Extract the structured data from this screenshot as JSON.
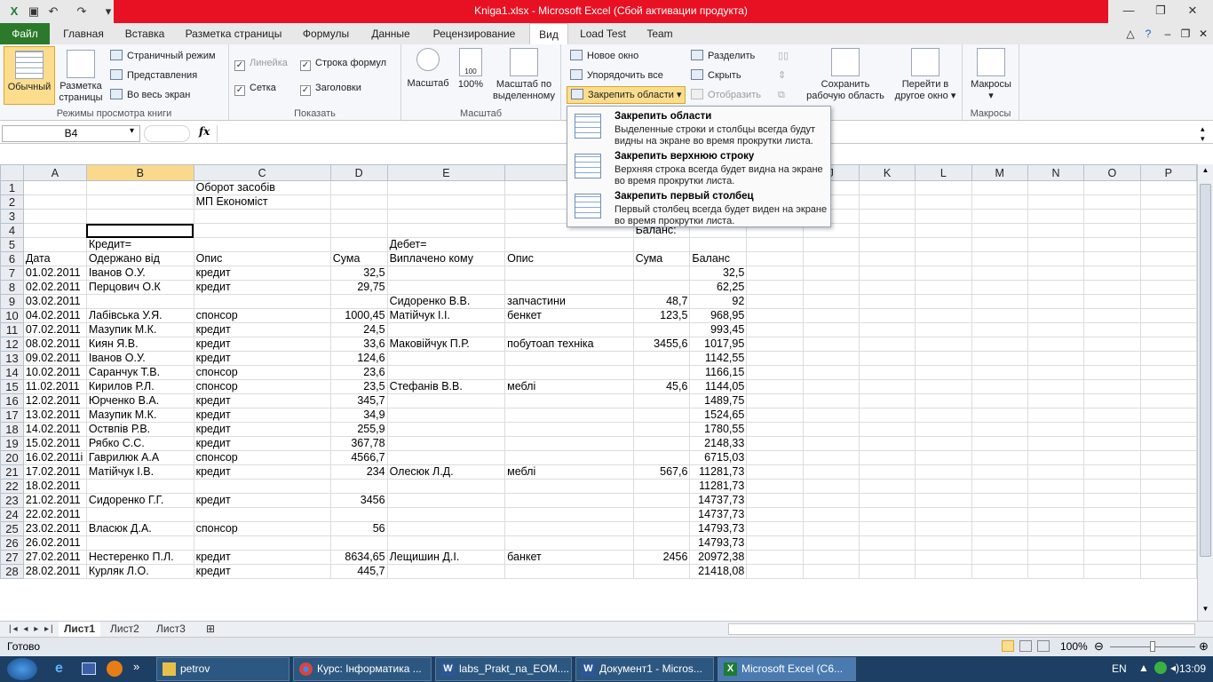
{
  "window": {
    "title": "Kniga1.xlsx  -  Microsoft Excel (Сбой активации продукта)",
    "minimize_icon": "minimize-icon",
    "restore_icon": "restore-icon",
    "close_icon": "close-icon",
    "accent_color": "#e81123"
  },
  "tabs": [
    "Файл",
    "Главная",
    "Вставка",
    "Разметка страницы",
    "Формулы",
    "Данные",
    "Рецензирование",
    "Вид",
    "Load Test",
    "Team"
  ],
  "active_tab": "Вид",
  "ribbon": {
    "views_group": {
      "label": "Режимы просмотра книги",
      "normal": "Обычный",
      "page_layout_line1": "Разметка",
      "page_layout_line2": "страницы",
      "page_mode": "Страничный режим",
      "views": "Представления",
      "full_screen": "Во весь экран"
    },
    "show_group": {
      "label": "Показать",
      "ruler": "Линейка",
      "formula_bar": "Строка формул",
      "grid": "Сетка",
      "headings": "Заголовки"
    },
    "zoom_group": {
      "label": "Масштаб",
      "zoom": "Масштаб",
      "zoom100": "100%",
      "zoom_sel_line1": "Масштаб по",
      "zoom_sel_line2": "выделенному"
    },
    "window_group": {
      "new_window": "Новое окно",
      "arrange_all": "Упорядочить все",
      "freeze": "Закрепить области",
      "split": "Разделить",
      "hide": "Скрыть",
      "unhide": "Отобразить",
      "save_ws_line1": "Сохранить",
      "save_ws_line2": "рабочую область",
      "switch_line1": "Перейти в",
      "switch_line2": "другое окно"
    },
    "macros_group": {
      "label": "Макросы",
      "macros": "Макросы"
    }
  },
  "formula_bar": {
    "name_box": "B4",
    "fx": "fx",
    "value": ""
  },
  "freeze_menu": [
    {
      "title": "Закрепить области",
      "desc": "Выделенные строки и столбцы всегда будут видны на экране во время прокрутки листа."
    },
    {
      "title": "Закрепить верхнюю строку",
      "desc": "Верхняя строка всегда будет видна на экране во время прокрутки листа."
    },
    {
      "title": "Закрепить первый столбец",
      "desc": "Первый столбец всегда будет виден на экране во время прокрутки листа."
    }
  ],
  "columns": [
    "A",
    "B",
    "C",
    "D",
    "E",
    "F",
    "G",
    "H",
    "I",
    "J",
    "K",
    "L",
    "M",
    "N",
    "O",
    "P"
  ],
  "selected_column": "B",
  "rows": [
    {
      "n": "1",
      "A": "",
      "B": "",
      "C": "Оборот засобів",
      "D": "",
      "E": "",
      "F": "",
      "G": "",
      "H": ""
    },
    {
      "n": "2",
      "A": "",
      "B": "",
      "C": "МП Економіст",
      "D": "",
      "E": "",
      "F": "",
      "G": "",
      "H": ""
    },
    {
      "n": "3",
      "A": "",
      "B": "",
      "C": "",
      "D": "",
      "E": "",
      "F": "",
      "G": "Початок",
      "H": ""
    },
    {
      "n": "4",
      "A": "",
      "B": "",
      "C": "",
      "D": "",
      "E": "",
      "F": "",
      "G": "Баланс:",
      "H": ""
    },
    {
      "n": "5",
      "A": "",
      "B": "Кредит=",
      "C": "",
      "D": "",
      "E": "Дебет=",
      "F": "",
      "G": "",
      "H": ""
    },
    {
      "n": "6",
      "A": "Дата",
      "B": "Одержано від",
      "C": "Опис",
      "D": "Сума",
      "E": "Виплачено кому",
      "F": "Опис",
      "G": "Сума",
      "H": "Баланс"
    },
    {
      "n": "7",
      "A": "01.02.2011",
      "B": "Іванов О.У.",
      "C": "кредит",
      "D": "32,5",
      "E": "",
      "F": "",
      "G": "",
      "H": "32,5"
    },
    {
      "n": "8",
      "A": "02.02.2011",
      "B": "Перцович О.К",
      "C": "кредит",
      "D": "29,75",
      "E": "",
      "F": "",
      "G": "",
      "H": "62,25"
    },
    {
      "n": "9",
      "A": "03.02.2011",
      "B": "",
      "C": "",
      "D": "",
      "E": "Сидоренко В.В.",
      "F": "запчастини",
      "G": "48,7",
      "H": "92"
    },
    {
      "n": "10",
      "A": "04.02.2011",
      "B": "Лабівська У.Я.",
      "C": "спонсор",
      "D": "1000,45",
      "E": "Матійчук І.І.",
      "F": "бенкет",
      "G": "123,5",
      "H": "968,95"
    },
    {
      "n": "11",
      "A": "07.02.2011",
      "B": "Мазупик М.К.",
      "C": "кредит",
      "D": "24,5",
      "E": "",
      "F": "",
      "G": "",
      "H": "993,45"
    },
    {
      "n": "12",
      "A": "08.02.2011",
      "B": "Киян Я.В.",
      "C": "кредит",
      "D": "33,6",
      "E": "Маковійчук П.Р.",
      "F": "побутоап техніка",
      "G": "3455,6",
      "H": "1017,95"
    },
    {
      "n": "13",
      "A": "09.02.2011",
      "B": "Іванов О.У.",
      "C": "кредит",
      "D": "124,6",
      "E": "",
      "F": "",
      "G": "",
      "H": "1142,55"
    },
    {
      "n": "14",
      "A": "10.02.2011",
      "B": "Саранчук Т.В.",
      "C": "спонсор",
      "D": "23,6",
      "E": "",
      "F": "",
      "G": "",
      "H": "1166,15"
    },
    {
      "n": "15",
      "A": "11.02.2011",
      "B": "Кирилов Р.Л.",
      "C": "спонсор",
      "D": "23,5",
      "E": "Стефанів В.В.",
      "F": "меблі",
      "G": "45,6",
      "H": "1144,05"
    },
    {
      "n": "16",
      "A": "12.02.2011",
      "B": "Юрченко В.А.",
      "C": "кредит",
      "D": "345,7",
      "E": "",
      "F": "",
      "G": "",
      "H": "1489,75"
    },
    {
      "n": "17",
      "A": "13.02.2011",
      "B": "Мазупик М.К.",
      "C": "кредит",
      "D": "34,9",
      "E": "",
      "F": "",
      "G": "",
      "H": "1524,65"
    },
    {
      "n": "18",
      "A": "14.02.2011",
      "B": "Оствпів Р.В.",
      "C": "кредит",
      "D": "255,9",
      "E": "",
      "F": "",
      "G": "",
      "H": "1780,55"
    },
    {
      "n": "19",
      "A": "15.02.2011",
      "B": "Рябко С.С.",
      "C": "кредит",
      "D": "367,78",
      "E": "",
      "F": "",
      "G": "",
      "H": "2148,33"
    },
    {
      "n": "20",
      "A": "16.02.2011і",
      "B": "Гаврилюк А.А",
      "C": "спонсор",
      "D": "4566,7",
      "E": "",
      "F": "",
      "G": "",
      "H": "6715,03"
    },
    {
      "n": "21",
      "A": "17.02.2011",
      "B": "Матійчук І.В.",
      "C": "кредит",
      "D": "234",
      "E": "Олесюк Л.Д.",
      "F": "меблі",
      "G": "567,6",
      "H": "11281,73"
    },
    {
      "n": "22",
      "A": "18.02.2011",
      "B": "",
      "C": "",
      "D": "",
      "E": "",
      "F": "",
      "G": "",
      "H": "11281,73"
    },
    {
      "n": "23",
      "A": "21.02.2011",
      "B": "Сидоренко Г.Г.",
      "C": "кредит",
      "D": "3456",
      "E": "",
      "F": "",
      "G": "",
      "H": "14737,73"
    },
    {
      "n": "24",
      "A": "22.02.2011",
      "B": "",
      "C": "",
      "D": "",
      "E": "",
      "F": "",
      "G": "",
      "H": "14737,73"
    },
    {
      "n": "25",
      "A": "23.02.2011",
      "B": "Власюк Д.А.",
      "C": "спонсор",
      "D": "56",
      "E": "",
      "F": "",
      "G": "",
      "H": "14793,73"
    },
    {
      "n": "26",
      "A": "26.02.2011",
      "B": "",
      "C": "",
      "D": "",
      "E": "",
      "F": "",
      "G": "",
      "H": "14793,73"
    },
    {
      "n": "27",
      "A": "27.02.2011",
      "B": "Нестеренко П.Л.",
      "C": "кредит",
      "D": "8634,65",
      "E": "Лещишин Д.І.",
      "F": "банкет",
      "G": "2456",
      "H": "20972,38"
    },
    {
      "n": "28",
      "A": "28.02.2011",
      "B": "Курляк Л.О.",
      "C": "кредит",
      "D": "445,7",
      "E": "",
      "F": "",
      "G": "",
      "H": "21418,08"
    }
  ],
  "sheet_tabs": [
    "Лист1",
    "Лист2",
    "Лист3"
  ],
  "active_sheet": "Лист1",
  "status": {
    "ready": "Готово",
    "zoom": "100%",
    "zoom_level": 1.0
  },
  "taskbar": {
    "items": [
      "petrov",
      "Курс: Інформатика ...",
      "labs_Prakt_na_EOM....",
      "Документ1 - Micros...",
      "Microsoft Excel (C6..."
    ],
    "lang": "EN",
    "time": "13:09"
  }
}
